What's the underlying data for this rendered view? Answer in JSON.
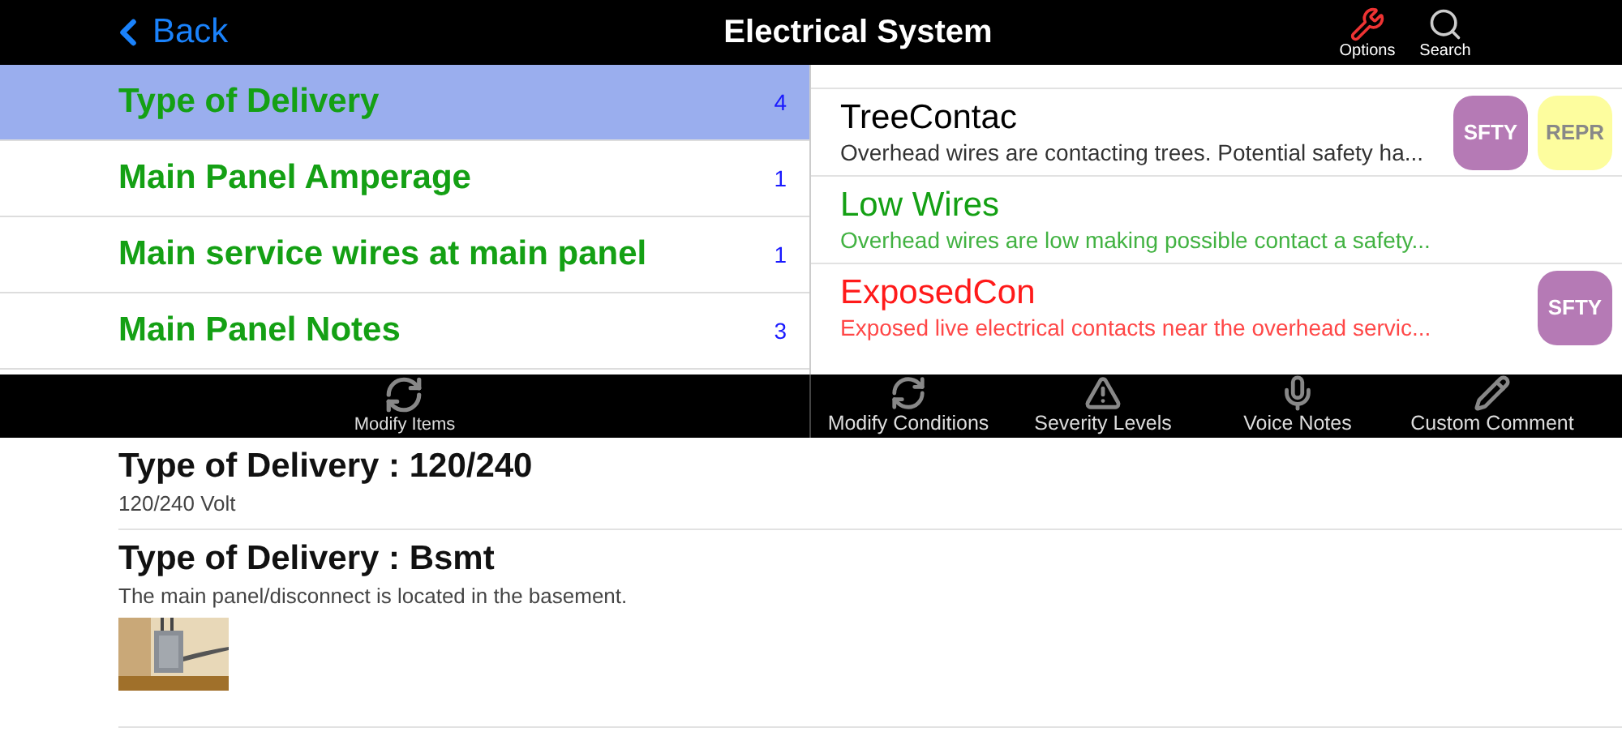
{
  "nav": {
    "back": "Back",
    "title": "Electrical System",
    "actions": [
      {
        "kind": "options",
        "label": "Options"
      },
      {
        "kind": "search",
        "label": "Search"
      }
    ]
  },
  "items": [
    {
      "name": "Type of Delivery",
      "count": "4",
      "selected": true
    },
    {
      "name": "Main Panel Amperage",
      "count": "1",
      "selected": false
    },
    {
      "name": "Main service wires at main panel",
      "count": "1",
      "selected": false
    },
    {
      "name": "Main Panel Notes",
      "count": "3",
      "selected": false
    }
  ],
  "conditions": [
    {
      "name": "TreeContac",
      "description": "Overhead wires are contacting trees. Potential safety ha...",
      "color": "#000000",
      "badges": [
        {
          "label": "SFTY",
          "color": "#b57ab5"
        },
        {
          "label": "REPR",
          "color": "#fdfd9e"
        }
      ]
    },
    {
      "name": "Low Wires",
      "description": "Overhead wires are low making possible contact a safety...",
      "color": "#14a014"
    },
    {
      "name": "ExposedCon",
      "description": "Exposed live electrical contacts near the overhead servic...",
      "color": "#ff1a1a",
      "badges": [
        {
          "label": "SFTY",
          "color": "#b57ab5"
        }
      ]
    }
  ],
  "toolbar_left": [
    {
      "kind": "modify",
      "label": "Modify Items"
    }
  ],
  "toolbar_right": [
    {
      "kind": "modify",
      "label": "Modify Conditions"
    },
    {
      "kind": "severity",
      "label": "Severity Levels"
    },
    {
      "kind": "voice",
      "label": "Voice Notes"
    },
    {
      "kind": "comment",
      "label": "Custom Comment"
    }
  ],
  "entries": [
    {
      "title": "Type of Delivery : 120/240",
      "description": "120/240 Volt"
    },
    {
      "title": "Type of Delivery : Bsmt",
      "description": "The main panel/disconnect is located in the basement."
    }
  ]
}
